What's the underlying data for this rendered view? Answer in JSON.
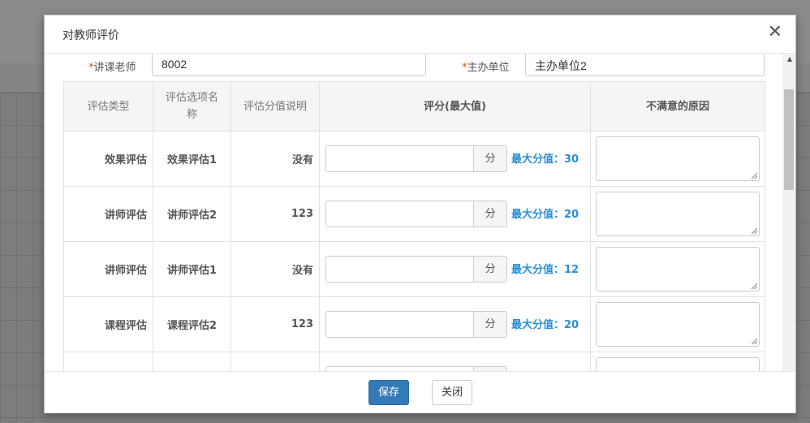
{
  "dialog": {
    "title": "对教师评价",
    "close_glyph": "✕"
  },
  "form": {
    "teacher": {
      "required_mark": "*",
      "label": "讲课老师",
      "value": "8002"
    },
    "organizer": {
      "required_mark": "*",
      "label": "主办单位",
      "value": "主办单位2"
    }
  },
  "table": {
    "headers": [
      "评估类型",
      "评估选项名称",
      "评估分值说明",
      "评分(最大值)",
      "不满意的原因"
    ],
    "rows": [
      {
        "type": "效果评估",
        "option": "效果评估1",
        "desc": "没有",
        "score": "",
        "unit": "分",
        "max_text": "最大分值：30",
        "reason": ""
      },
      {
        "type": "讲师评估",
        "option": "讲师评估2",
        "desc": "123",
        "score": "",
        "unit": "分",
        "max_text": "最大分值：20",
        "reason": ""
      },
      {
        "type": "讲师评估",
        "option": "讲师评估1",
        "desc": "没有",
        "score": "",
        "unit": "分",
        "max_text": "最大分值：12",
        "reason": ""
      },
      {
        "type": "课程评估",
        "option": "课程评估2",
        "desc": "123",
        "score": "",
        "unit": "分",
        "max_text": "最大分值：20",
        "reason": ""
      },
      {
        "type": "",
        "option": "",
        "desc": "",
        "score": "",
        "unit": "",
        "max_text": "",
        "reason": ""
      }
    ]
  },
  "footer": {
    "save_label": "保存",
    "close_label": "关闭"
  },
  "colors": {
    "primary": "#337ab7",
    "max_score_text": "#2a8fd6",
    "required": "#e14c00"
  }
}
